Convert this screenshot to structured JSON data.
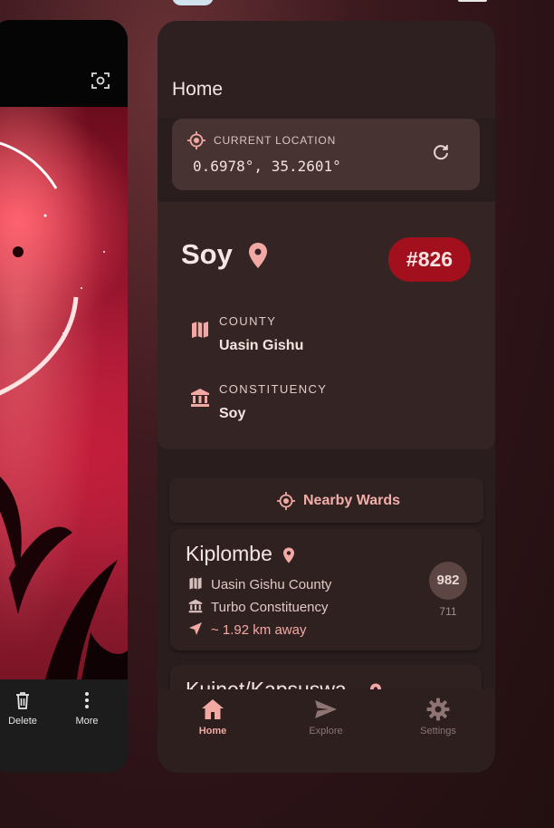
{
  "gallery_card": {
    "actions": [
      {
        "label": "Delete",
        "icon": "trash-icon"
      },
      {
        "label": "More",
        "icon": "more-vertical-icon"
      }
    ]
  },
  "app": {
    "title": "Home",
    "current_location": {
      "label": "CURRENT LOCATION",
      "coords": "0.6978°, 35.2601°"
    },
    "ward": {
      "name": "Soy",
      "badge": "#826",
      "county_label": "COUNTY",
      "county": "Uasin Gishu",
      "constituency_label": "CONSTITUENCY",
      "constituency": "Soy"
    },
    "nearby_button": "Nearby Wards",
    "nearby": [
      {
        "name": "Kiplombe",
        "county": "Uasin Gishu County",
        "constituency": "Turbo Constituency",
        "distance": "~ 1.92 km away",
        "number": "982",
        "sub": "711"
      },
      {
        "name": "Kuinet/Kapsuswa"
      }
    ],
    "nav": [
      {
        "label": "Home",
        "icon": "home-icon",
        "active": true
      },
      {
        "label": "Explore",
        "icon": "send-icon",
        "active": false
      },
      {
        "label": "Settings",
        "icon": "gear-icon",
        "active": false
      }
    ]
  },
  "colors": {
    "accent": "#f2a9a3",
    "badge": "#a2101e",
    "surface": "#2a1d1d"
  }
}
